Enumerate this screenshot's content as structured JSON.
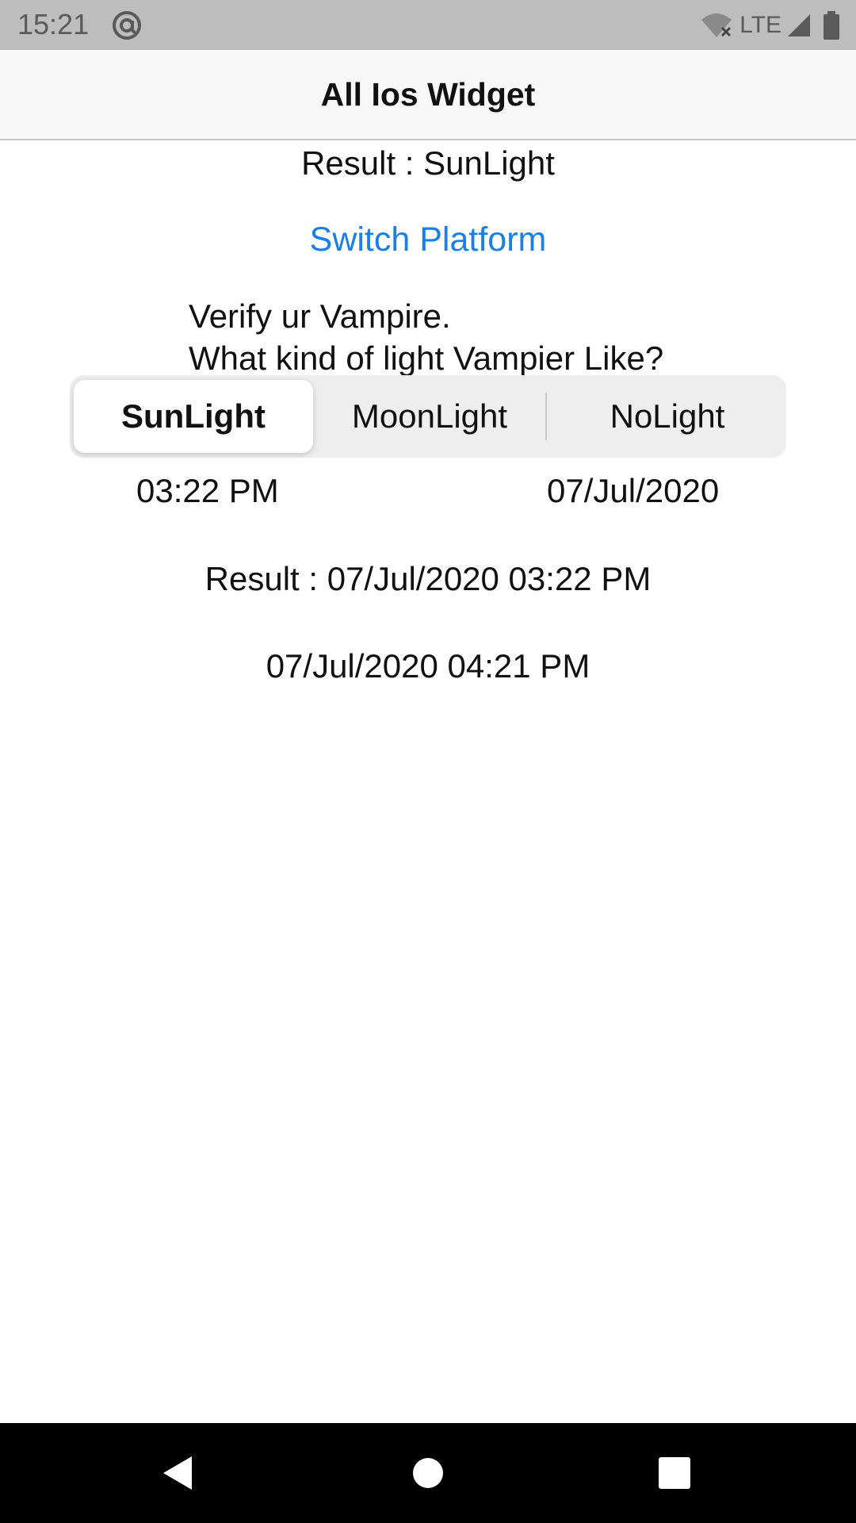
{
  "status_bar": {
    "time": "15:21",
    "network": "LTE"
  },
  "nav": {
    "title": "All Ios Widget"
  },
  "segment_result": "Result : SunLight",
  "switch_platform_label": "Switch Platform",
  "question": {
    "line1": "Verify ur Vampire.",
    "line2": "What kind of light Vampier Like?"
  },
  "segmented_control": {
    "options": [
      "SunLight",
      "MoonLight",
      "NoLight"
    ],
    "selected": "SunLight"
  },
  "picker": {
    "time": "03:22 PM",
    "date": "07/Jul/2020"
  },
  "datetime_result": "Result : 07/Jul/2020 03:22 PM",
  "datetime_value": "07/Jul/2020 04:21 PM",
  "colors": {
    "accent": "#1a7fe6",
    "status_bar": "#bdbdbd",
    "segment_bg": "#eeeeef"
  },
  "icons": {
    "status": [
      "at-sign-icon",
      "wifi-off-icon",
      "signal-icon",
      "battery-icon"
    ],
    "system_nav": [
      "back-icon",
      "home-icon",
      "recents-icon"
    ]
  }
}
